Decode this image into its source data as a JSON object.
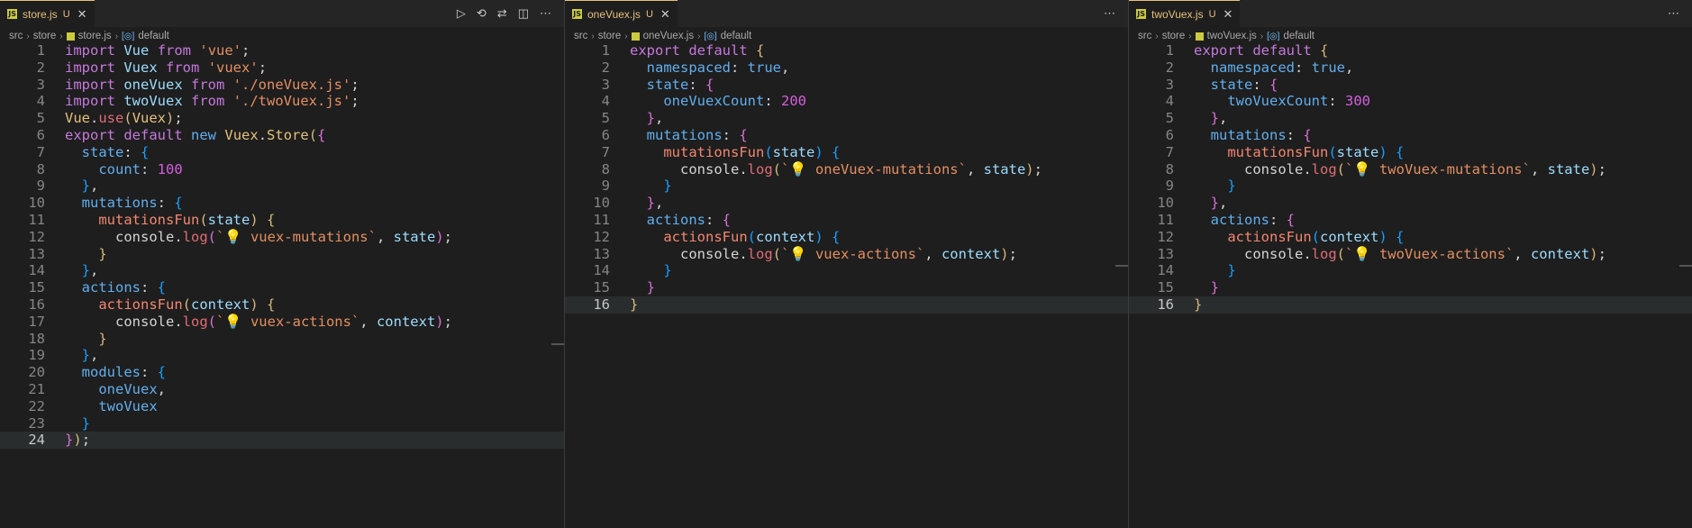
{
  "panes": [
    {
      "id": "store",
      "tab": {
        "name": "store.js",
        "badge": "U",
        "close": "✕"
      },
      "actions": [
        "▷",
        "⟲",
        "⇄",
        "◫",
        "⋯"
      ],
      "breadcrumb": [
        "src",
        "store",
        "store.js",
        "default"
      ],
      "current_line": 24,
      "lines": [
        [
          [
            "k",
            "import"
          ],
          [
            "tx",
            " "
          ],
          [
            "id",
            "Vue"
          ],
          [
            "tx",
            " "
          ],
          [
            "k",
            "from"
          ],
          [
            "tx",
            " "
          ],
          [
            "s",
            "'vue'"
          ],
          [
            "tx",
            ";"
          ]
        ],
        [
          [
            "k",
            "import"
          ],
          [
            "tx",
            " "
          ],
          [
            "id",
            "Vuex"
          ],
          [
            "tx",
            " "
          ],
          [
            "k",
            "from"
          ],
          [
            "tx",
            " "
          ],
          [
            "s",
            "'vuex'"
          ],
          [
            "tx",
            ";"
          ]
        ],
        [
          [
            "k",
            "import"
          ],
          [
            "tx",
            " "
          ],
          [
            "id",
            "oneVuex"
          ],
          [
            "tx",
            " "
          ],
          [
            "k",
            "from"
          ],
          [
            "tx",
            " "
          ],
          [
            "s",
            "'./oneVuex.js'"
          ],
          [
            "tx",
            ";"
          ]
        ],
        [
          [
            "k",
            "import"
          ],
          [
            "tx",
            " "
          ],
          [
            "id",
            "twoVuex"
          ],
          [
            "tx",
            " "
          ],
          [
            "k",
            "from"
          ],
          [
            "tx",
            " "
          ],
          [
            "s",
            "'./twoVuex.js'"
          ],
          [
            "tx",
            ";"
          ]
        ],
        [
          [
            "cl",
            "Vue"
          ],
          [
            "tx",
            "."
          ],
          [
            "n",
            "use"
          ],
          [
            "b",
            "("
          ],
          [
            "cl",
            "Vuex"
          ],
          [
            "b",
            ")"
          ],
          [
            "tx",
            ";"
          ]
        ],
        [
          [
            "k",
            "export"
          ],
          [
            "tx",
            " "
          ],
          [
            "k",
            "default"
          ],
          [
            "tx",
            " "
          ],
          [
            "p",
            "new"
          ],
          [
            "tx",
            " "
          ],
          [
            "cl",
            "Vuex"
          ],
          [
            "tx",
            "."
          ],
          [
            "cl",
            "Store"
          ],
          [
            "b",
            "("
          ],
          [
            "bm",
            "{"
          ]
        ],
        [
          [
            "tx",
            "  "
          ],
          [
            "p",
            "state"
          ],
          [
            "tx",
            ": "
          ],
          [
            "bb",
            "{"
          ]
        ],
        [
          [
            "tx",
            "    "
          ],
          [
            "p",
            "count"
          ],
          [
            "tx",
            ": "
          ],
          [
            "num",
            "100"
          ]
        ],
        [
          [
            "tx",
            "  "
          ],
          [
            "bb",
            "}"
          ],
          [
            "tx",
            ","
          ]
        ],
        [
          [
            "tx",
            "  "
          ],
          [
            "p",
            "mutations"
          ],
          [
            "tx",
            ": "
          ],
          [
            "bb",
            "{"
          ]
        ],
        [
          [
            "tx",
            "    "
          ],
          [
            "f",
            "mutationsFun"
          ],
          [
            "b",
            "("
          ],
          [
            "id",
            "state"
          ],
          [
            "b",
            ")"
          ],
          [
            "tx",
            " "
          ],
          [
            "b",
            "{"
          ]
        ],
        [
          [
            "tx",
            "      "
          ],
          [
            "tx",
            "console"
          ],
          [
            "tx",
            "."
          ],
          [
            "n",
            "log"
          ],
          [
            "bm",
            "("
          ],
          [
            "s",
            "`💡 vuex-mutations`"
          ],
          [
            "tx",
            ", "
          ],
          [
            "id",
            "state"
          ],
          [
            "bm",
            ")"
          ],
          [
            "tx",
            ";"
          ]
        ],
        [
          [
            "tx",
            "    "
          ],
          [
            "b",
            "}"
          ]
        ],
        [
          [
            "tx",
            "  "
          ],
          [
            "bb",
            "}"
          ],
          [
            "tx",
            ","
          ]
        ],
        [
          [
            "tx",
            "  "
          ],
          [
            "p",
            "actions"
          ],
          [
            "tx",
            ": "
          ],
          [
            "bb",
            "{"
          ]
        ],
        [
          [
            "tx",
            "    "
          ],
          [
            "f",
            "actionsFun"
          ],
          [
            "b",
            "("
          ],
          [
            "id",
            "context"
          ],
          [
            "b",
            ")"
          ],
          [
            "tx",
            " "
          ],
          [
            "b",
            "{"
          ]
        ],
        [
          [
            "tx",
            "      "
          ],
          [
            "tx",
            "console"
          ],
          [
            "tx",
            "."
          ],
          [
            "n",
            "log"
          ],
          [
            "bm",
            "("
          ],
          [
            "s",
            "`💡 vuex-actions`"
          ],
          [
            "tx",
            ", "
          ],
          [
            "id",
            "context"
          ],
          [
            "bm",
            ")"
          ],
          [
            "tx",
            ";"
          ]
        ],
        [
          [
            "tx",
            "    "
          ],
          [
            "b",
            "}"
          ]
        ],
        [
          [
            "tx",
            "  "
          ],
          [
            "bb",
            "}"
          ],
          [
            "tx",
            ","
          ]
        ],
        [
          [
            "tx",
            "  "
          ],
          [
            "p",
            "modules"
          ],
          [
            "tx",
            ": "
          ],
          [
            "bb",
            "{"
          ]
        ],
        [
          [
            "tx",
            "    "
          ],
          [
            "p",
            "oneVuex"
          ],
          [
            "tx",
            ","
          ]
        ],
        [
          [
            "tx",
            "    "
          ],
          [
            "p",
            "twoVuex"
          ]
        ],
        [
          [
            "tx",
            "  "
          ],
          [
            "bb",
            "}"
          ]
        ],
        [
          [
            "bm",
            "}"
          ],
          [
            "b",
            ")"
          ],
          [
            "tx",
            ";"
          ]
        ]
      ]
    },
    {
      "id": "onevuex",
      "tab": {
        "name": "oneVuex.js",
        "badge": "U",
        "close": "✕"
      },
      "actions": [
        "⋯"
      ],
      "breadcrumb": [
        "src",
        "store",
        "oneVuex.js",
        "default"
      ],
      "current_line": 16,
      "lines": [
        [
          [
            "k",
            "export"
          ],
          [
            "tx",
            " "
          ],
          [
            "k",
            "default"
          ],
          [
            "tx",
            " "
          ],
          [
            "b",
            "{"
          ]
        ],
        [
          [
            "tx",
            "  "
          ],
          [
            "p",
            "namespaced"
          ],
          [
            "tx",
            ": "
          ],
          [
            "p",
            "true"
          ],
          [
            "tx",
            ","
          ]
        ],
        [
          [
            "tx",
            "  "
          ],
          [
            "p",
            "state"
          ],
          [
            "tx",
            ": "
          ],
          [
            "bm",
            "{"
          ]
        ],
        [
          [
            "tx",
            "    "
          ],
          [
            "p",
            "oneVuexCount"
          ],
          [
            "tx",
            ": "
          ],
          [
            "num",
            "200"
          ]
        ],
        [
          [
            "tx",
            "  "
          ],
          [
            "bm",
            "}"
          ],
          [
            "tx",
            ","
          ]
        ],
        [
          [
            "tx",
            "  "
          ],
          [
            "p",
            "mutations"
          ],
          [
            "tx",
            ": "
          ],
          [
            "bm",
            "{"
          ]
        ],
        [
          [
            "tx",
            "    "
          ],
          [
            "f",
            "mutationsFun"
          ],
          [
            "bb",
            "("
          ],
          [
            "id",
            "state"
          ],
          [
            "bb",
            ")"
          ],
          [
            "tx",
            " "
          ],
          [
            "bb",
            "{"
          ]
        ],
        [
          [
            "tx",
            "      "
          ],
          [
            "tx",
            "console"
          ],
          [
            "tx",
            "."
          ],
          [
            "n",
            "log"
          ],
          [
            "b",
            "("
          ],
          [
            "s",
            "`💡 oneVuex-mutations`"
          ],
          [
            "tx",
            ", "
          ],
          [
            "id",
            "state"
          ],
          [
            "b",
            ")"
          ],
          [
            "tx",
            ";"
          ]
        ],
        [
          [
            "tx",
            "    "
          ],
          [
            "bb",
            "}"
          ]
        ],
        [
          [
            "tx",
            "  "
          ],
          [
            "bm",
            "}"
          ],
          [
            "tx",
            ","
          ]
        ],
        [
          [
            "tx",
            "  "
          ],
          [
            "p",
            "actions"
          ],
          [
            "tx",
            ": "
          ],
          [
            "bm",
            "{"
          ]
        ],
        [
          [
            "tx",
            "    "
          ],
          [
            "f",
            "actionsFun"
          ],
          [
            "bb",
            "("
          ],
          [
            "id",
            "context"
          ],
          [
            "bb",
            ")"
          ],
          [
            "tx",
            " "
          ],
          [
            "bb",
            "{"
          ]
        ],
        [
          [
            "tx",
            "      "
          ],
          [
            "tx",
            "console"
          ],
          [
            "tx",
            "."
          ],
          [
            "n",
            "log"
          ],
          [
            "b",
            "("
          ],
          [
            "s",
            "`💡 vuex-actions`"
          ],
          [
            "tx",
            ", "
          ],
          [
            "id",
            "context"
          ],
          [
            "b",
            ")"
          ],
          [
            "tx",
            ";"
          ]
        ],
        [
          [
            "tx",
            "    "
          ],
          [
            "bb",
            "}"
          ]
        ],
        [
          [
            "tx",
            "  "
          ],
          [
            "bm",
            "}"
          ]
        ],
        [
          [
            "b",
            "}"
          ]
        ]
      ]
    },
    {
      "id": "twovuex",
      "tab": {
        "name": "twoVuex.js",
        "badge": "U",
        "close": "✕"
      },
      "actions": [
        "⋯"
      ],
      "breadcrumb": [
        "src",
        "store",
        "twoVuex.js",
        "default"
      ],
      "current_line": 16,
      "lines": [
        [
          [
            "k",
            "export"
          ],
          [
            "tx",
            " "
          ],
          [
            "k",
            "default"
          ],
          [
            "tx",
            " "
          ],
          [
            "b",
            "{"
          ]
        ],
        [
          [
            "tx",
            "  "
          ],
          [
            "p",
            "namespaced"
          ],
          [
            "tx",
            ": "
          ],
          [
            "p",
            "true"
          ],
          [
            "tx",
            ","
          ]
        ],
        [
          [
            "tx",
            "  "
          ],
          [
            "p",
            "state"
          ],
          [
            "tx",
            ": "
          ],
          [
            "bm",
            "{"
          ]
        ],
        [
          [
            "tx",
            "    "
          ],
          [
            "p",
            "twoVuexCount"
          ],
          [
            "tx",
            ": "
          ],
          [
            "num",
            "300"
          ]
        ],
        [
          [
            "tx",
            "  "
          ],
          [
            "bm",
            "}"
          ],
          [
            "tx",
            ","
          ]
        ],
        [
          [
            "tx",
            "  "
          ],
          [
            "p",
            "mutations"
          ],
          [
            "tx",
            ": "
          ],
          [
            "bm",
            "{"
          ]
        ],
        [
          [
            "tx",
            "    "
          ],
          [
            "f",
            "mutationsFun"
          ],
          [
            "bb",
            "("
          ],
          [
            "id",
            "state"
          ],
          [
            "bb",
            ")"
          ],
          [
            "tx",
            " "
          ],
          [
            "bb",
            "{"
          ]
        ],
        [
          [
            "tx",
            "      "
          ],
          [
            "tx",
            "console"
          ],
          [
            "tx",
            "."
          ],
          [
            "n",
            "log"
          ],
          [
            "b",
            "("
          ],
          [
            "s",
            "`💡 twoVuex-mutations`"
          ],
          [
            "tx",
            ", "
          ],
          [
            "id",
            "state"
          ],
          [
            "b",
            ")"
          ],
          [
            "tx",
            ";"
          ]
        ],
        [
          [
            "tx",
            "    "
          ],
          [
            "bb",
            "}"
          ]
        ],
        [
          [
            "tx",
            "  "
          ],
          [
            "bm",
            "}"
          ],
          [
            "tx",
            ","
          ]
        ],
        [
          [
            "tx",
            "  "
          ],
          [
            "p",
            "actions"
          ],
          [
            "tx",
            ": "
          ],
          [
            "bm",
            "{"
          ]
        ],
        [
          [
            "tx",
            "    "
          ],
          [
            "f",
            "actionsFun"
          ],
          [
            "bb",
            "("
          ],
          [
            "id",
            "context"
          ],
          [
            "bb",
            ")"
          ],
          [
            "tx",
            " "
          ],
          [
            "bb",
            "{"
          ]
        ],
        [
          [
            "tx",
            "      "
          ],
          [
            "tx",
            "console"
          ],
          [
            "tx",
            "."
          ],
          [
            "n",
            "log"
          ],
          [
            "b",
            "("
          ],
          [
            "s",
            "`💡 twoVuex-actions`"
          ],
          [
            "tx",
            ", "
          ],
          [
            "id",
            "context"
          ],
          [
            "b",
            ")"
          ],
          [
            "tx",
            ";"
          ]
        ],
        [
          [
            "tx",
            "    "
          ],
          [
            "bb",
            "}"
          ]
        ],
        [
          [
            "tx",
            "  "
          ],
          [
            "bm",
            "}"
          ]
        ],
        [
          [
            "b",
            "}"
          ]
        ]
      ]
    }
  ]
}
